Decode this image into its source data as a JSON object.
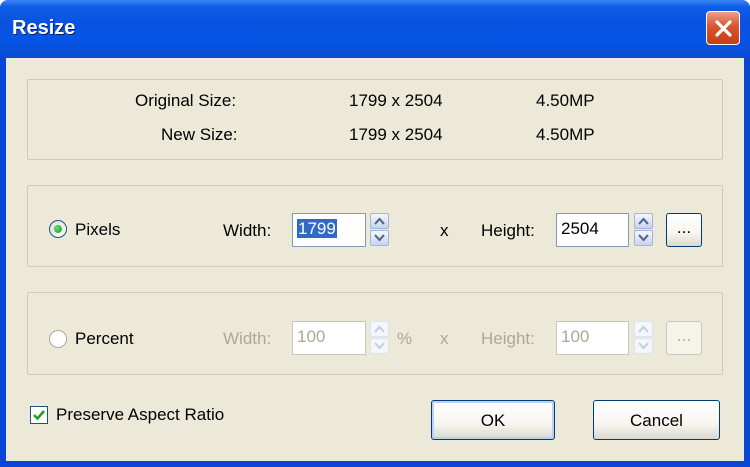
{
  "window": {
    "title": "Resize"
  },
  "info": {
    "original_label": "Original Size:",
    "original_dims": "1799 x 2504",
    "original_mp": "4.50MP",
    "new_label": "New Size:",
    "new_dims": "1799 x 2504",
    "new_mp": "4.50MP"
  },
  "pixels": {
    "radio_label": "Pixels",
    "selected": true,
    "width_label": "Width:",
    "width_value": "1799",
    "x_sep": "x",
    "height_label": "Height:",
    "height_value": "2504",
    "browse_label": "..."
  },
  "percent": {
    "radio_label": "Percent",
    "selected": false,
    "width_label": "Width:",
    "width_value": "100",
    "unit": "%",
    "x_sep": "x",
    "height_label": "Height:",
    "height_value": "100",
    "browse_label": "..."
  },
  "preserve_aspect": {
    "label": "Preserve Aspect Ratio",
    "checked": true
  },
  "buttons": {
    "ok": "OK",
    "cancel": "Cancel"
  },
  "colors": {
    "title_bar": "#0a52e0",
    "dialog_bg": "#ece9d8",
    "selection": "#316ac5",
    "radio_dot": "#1f9c1f"
  },
  "icons": {
    "close": "close-icon",
    "spin_up": "chevron-up-icon",
    "spin_down": "chevron-down-icon",
    "check": "checkmark-icon"
  }
}
